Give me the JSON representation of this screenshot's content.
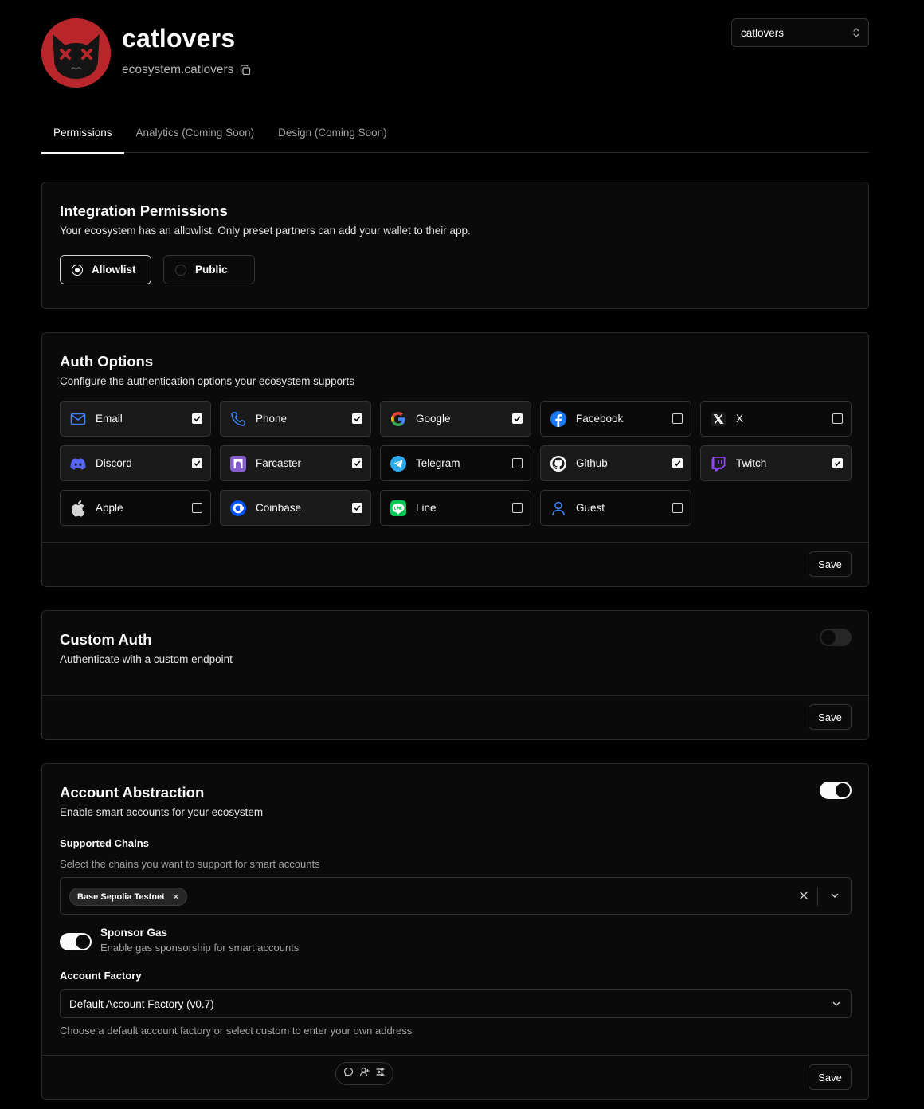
{
  "header": {
    "title": "catlovers",
    "subtitle": "ecosystem.catlovers",
    "team_select_value": "catlovers"
  },
  "tabs": [
    {
      "label": "Permissions",
      "active": true
    },
    {
      "label": "Analytics (Coming Soon)",
      "active": false
    },
    {
      "label": "Design (Coming Soon)",
      "active": false
    }
  ],
  "integration": {
    "title": "Integration Permissions",
    "desc": "Your ecosystem has an allowlist. Only preset partners can add your wallet to their app.",
    "options": [
      {
        "label": "Allowlist",
        "selected": true
      },
      {
        "label": "Public",
        "selected": false
      }
    ]
  },
  "auth": {
    "title": "Auth Options",
    "desc": "Configure the authentication options your ecosystem supports",
    "items": [
      {
        "label": "Email",
        "icon": "mail-icon",
        "checked": true
      },
      {
        "label": "Phone",
        "icon": "phone-icon",
        "checked": true
      },
      {
        "label": "Google",
        "icon": "google-icon",
        "checked": true
      },
      {
        "label": "Facebook",
        "icon": "facebook-icon",
        "checked": false
      },
      {
        "label": "X",
        "icon": "x-icon",
        "checked": false
      },
      {
        "label": "Discord",
        "icon": "discord-icon",
        "checked": true
      },
      {
        "label": "Farcaster",
        "icon": "farcaster-icon",
        "checked": true
      },
      {
        "label": "Telegram",
        "icon": "telegram-icon",
        "checked": false
      },
      {
        "label": "Github",
        "icon": "github-icon",
        "checked": true
      },
      {
        "label": "Twitch",
        "icon": "twitch-icon",
        "checked": true
      },
      {
        "label": "Apple",
        "icon": "apple-icon",
        "checked": false
      },
      {
        "label": "Coinbase",
        "icon": "coinbase-icon",
        "checked": true
      },
      {
        "label": "Line",
        "icon": "line-icon",
        "checked": false
      },
      {
        "label": "Guest",
        "icon": "user-icon",
        "checked": false
      }
    ],
    "save_label": "Save"
  },
  "custom_auth": {
    "title": "Custom Auth",
    "desc": "Authenticate with a custom endpoint",
    "enabled": false,
    "save_label": "Save"
  },
  "account_abstraction": {
    "title": "Account Abstraction",
    "desc": "Enable smart accounts for your ecosystem",
    "enabled": true,
    "chains_label": "Supported Chains",
    "chains_help": "Select the chains you want to support for smart accounts",
    "chains": [
      "Base Sepolia Testnet"
    ],
    "sponsor_gas_label": "Sponsor Gas",
    "sponsor_gas_desc": "Enable gas sponsorship for smart accounts",
    "sponsor_gas_enabled": true,
    "factory_label": "Account Factory",
    "factory_value": "Default Account Factory (v0.7)",
    "factory_help": "Choose a default account factory or select custom to enter your own address",
    "save_label": "Save"
  },
  "colors": {
    "background": "#000000",
    "card": "#0a0a0a",
    "border": "#2a2a2a",
    "avatar": "#b8262b",
    "accent_blue": "#3b82f6"
  }
}
